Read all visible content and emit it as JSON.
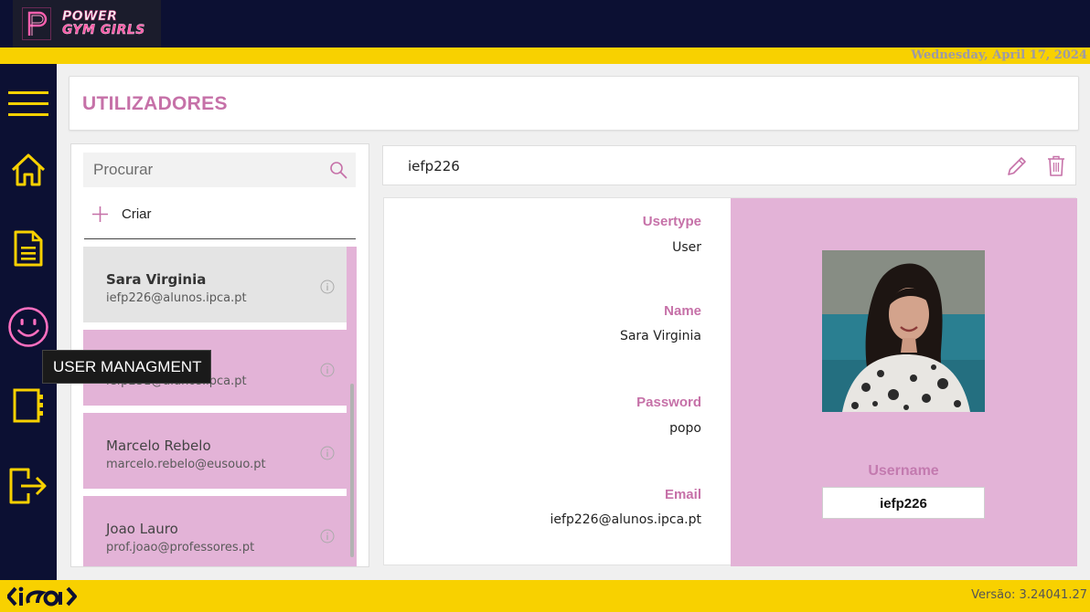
{
  "app": {
    "logo_line1": "POWER",
    "logo_line2": "GYM GIRLS",
    "date": "Wednesday, April 17, 2024",
    "version": "Versão: 3.24041.27",
    "footer_logo_icon": "ipca-logo-icon"
  },
  "colors": {
    "navy": "#0c1033",
    "yellow": "#f8d100",
    "pink": "#e3b3d7",
    "accent": "#c671a8"
  },
  "sidebar": {
    "items": [
      {
        "icon": "hamburger-menu-icon"
      },
      {
        "icon": "home-icon"
      },
      {
        "icon": "document-icon"
      },
      {
        "icon": "smiley-icon",
        "tooltip": "USER MANAGMENT"
      },
      {
        "icon": "notebook-icon"
      },
      {
        "icon": "logout-icon"
      }
    ]
  },
  "page": {
    "title": "UTILIZADORES"
  },
  "search": {
    "placeholder": "Procurar",
    "icon": "search-icon"
  },
  "create": {
    "label": "Criar",
    "icon": "plus-icon"
  },
  "users": [
    {
      "name": "Sara Virginia",
      "email": "iefp226@alunos.ipca.pt",
      "selected": true
    },
    {
      "name": "",
      "email": "iefp231@alunos.ipca.pt",
      "selected": false
    },
    {
      "name": "Marcelo Rebelo",
      "email": "marcelo.rebelo@eusouo.pt",
      "selected": false
    },
    {
      "name": "Joao Lauro",
      "email": "prof.joao@professores.pt",
      "selected": false
    }
  ],
  "detail": {
    "username": "iefp226",
    "edit_icon": "pencil-icon",
    "delete_icon": "trash-icon",
    "fields": [
      {
        "label": "Usertype",
        "value": "User"
      },
      {
        "label": "Name",
        "value": "Sara Virginia"
      },
      {
        "label": "Password",
        "value": "popo"
      },
      {
        "label": "Email",
        "value": "iefp226@alunos.ipca.pt"
      }
    ],
    "username_label": "Username",
    "username_value": "iefp226",
    "photo_icon": "user-photo"
  }
}
